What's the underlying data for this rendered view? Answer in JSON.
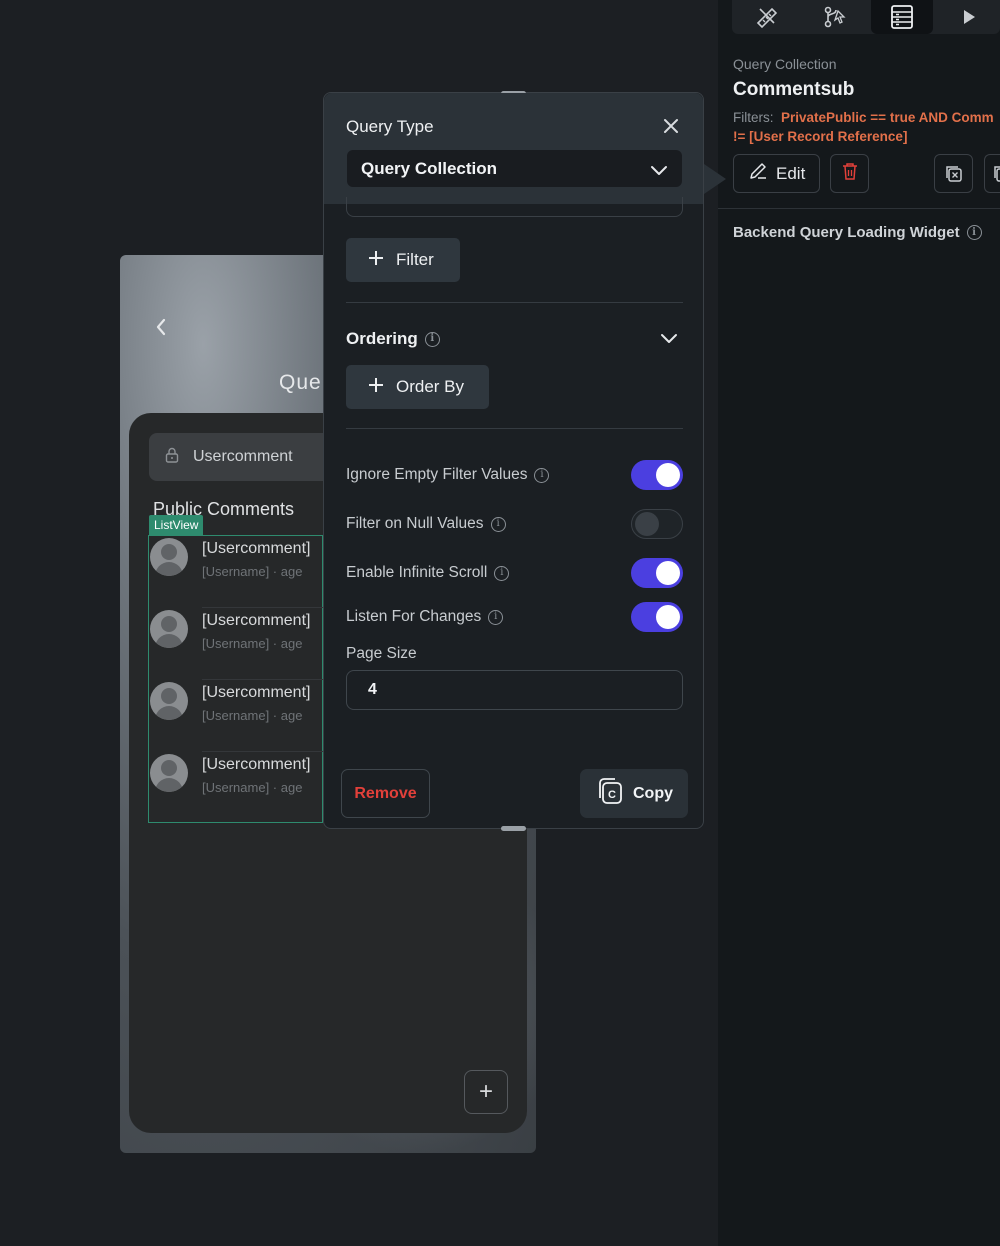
{
  "phone": {
    "title_partial": "Que",
    "search_field": "Usercomment",
    "heading": "Public Comments",
    "list_badge": "ListView",
    "items": [
      {
        "name": "[Usercomment]",
        "sub": "[Username]  ·  age"
      },
      {
        "name": "[Usercomment]",
        "sub": "[Username]  ·  age"
      },
      {
        "name": "[Usercomment]",
        "sub": "[Username]  ·  age"
      },
      {
        "name": "[Usercomment]",
        "sub": "[Username]  ·  age"
      }
    ],
    "fab_label": "+"
  },
  "popup": {
    "title": "Query Type",
    "query_type_value": "Query Collection",
    "filter_button": "Filter",
    "ordering_label": "Ordering",
    "order_by_button": "Order By",
    "options": [
      {
        "label": "Ignore Empty Filter Values",
        "enabled": true
      },
      {
        "label": "Filter on Null Values",
        "enabled": false
      },
      {
        "label": "Enable Infinite Scroll",
        "enabled": true
      },
      {
        "label": "Listen For Changes",
        "enabled": true
      }
    ],
    "page_size_label": "Page Size",
    "page_size_value": "4",
    "remove_button": "Remove",
    "copy_button": "Copy"
  },
  "right_panel": {
    "section_label": "Query Collection",
    "collection_name": "Commentsub",
    "filters_label": "Filters:",
    "filters_value_line1": "PrivatePublic == true AND Comm",
    "filters_value_line2": "!= [User Record Reference]",
    "edit_button": "Edit",
    "backend_query_label": "Backend Query Loading Widget"
  },
  "colors": {
    "accent_toggle": "#4b3fe0",
    "filter_text": "#e2704a",
    "remove_text": "#e2403a",
    "listview_border": "#2e8b6e"
  },
  "icons": {
    "tabs": [
      "paint-tools-icon",
      "branch-flow-icon",
      "database-table-icon",
      "play-icon"
    ]
  }
}
